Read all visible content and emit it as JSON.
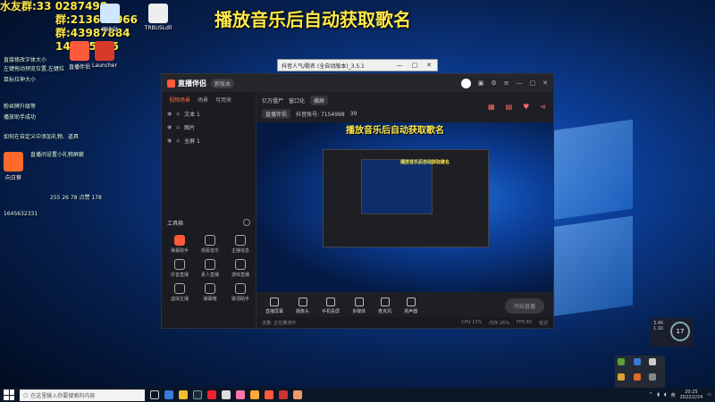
{
  "banner": {
    "title": "播放音乐后自动获取歌名"
  },
  "fan_overlay": {
    "line1": "水友群:33",
    "line1b": "0287498",
    "line2": "群:213663066",
    "line3": "群:43987884",
    "line4": "1481",
    "line4b": "5275"
  },
  "desktop": {
    "icons": [
      {
        "label": "回收站"
      },
      {
        "label": "TRBUSLdll"
      },
      {
        "label": "直播伴侣"
      },
      {
        "label": "Launcher"
      },
      {
        "label": "向日葵"
      }
    ],
    "left_texts": [
      "直接修改字体大小",
      "左键拖动预览位置,左键拉",
      "鼠标拉伸大小",
      "粉丝牌升级等",
      "播放助手成功",
      "如何在自定义中添加礼物、道具",
      "直播间设置小礼物屏蔽",
      "1645632331",
      "255 26 78 点赞 178"
    ]
  },
  "mini_window": {
    "title": "抖音人气/歌名 (全自动版本)_3.5.1"
  },
  "app": {
    "name": "直播伴侣",
    "version": "新版本",
    "sidebar_tabs": [
      "视频场景",
      "场景",
      "可用来"
    ],
    "scenes": [
      {
        "label": "文本 1"
      },
      {
        "label": "图片"
      },
      {
        "label": "全屏 1"
      }
    ],
    "tools_title": "工具箱",
    "tools": [
      {
        "label": "弹幕助手",
        "hot": true
      },
      {
        "label": "观看音乐",
        "hot": false
      },
      {
        "label": "主播信息",
        "hot": false
      },
      {
        "label": "抖音直播",
        "hot": false
      },
      {
        "label": "素人直播",
        "hot": false
      },
      {
        "label": "游戏直播",
        "hot": false
      },
      {
        "label": "虚拟主播",
        "hot": false
      },
      {
        "label": "弹幕箱",
        "hot": false
      },
      {
        "label": "歌词助手",
        "hot": false
      }
    ],
    "top_row": {
      "left": "亿万僵尸",
      "mid": "窗口化",
      "tag": "横屏"
    },
    "top_row2": {
      "a": "直播伴侣",
      "b": "抖音账号: 7154998",
      "c": "39"
    },
    "preview_title": "播放音乐后自动获取歌名",
    "nested_title": "播放音乐后自动获取歌名",
    "bottom_buttons": [
      {
        "label": "直播屏幕"
      },
      {
        "label": "摄像头"
      },
      {
        "label": "手机投屏"
      },
      {
        "label": "多媒体"
      },
      {
        "label": "麦克风"
      },
      {
        "label": "扬声器"
      }
    ],
    "live_button": "开始直播",
    "status": {
      "left": "流量: 正在推流中",
      "cpu": "CPU 13%",
      "mem": "内存 26%",
      "fps": "FPS 60",
      "right": "延迟"
    }
  },
  "gauge": {
    "value": "17",
    "label_top": "3.4K",
    "label_bot": "1.1K"
  },
  "taskbar": {
    "search_placeholder": "在这里输入你要搜索的内容",
    "time": "20:25",
    "date": "2022/2/24"
  }
}
